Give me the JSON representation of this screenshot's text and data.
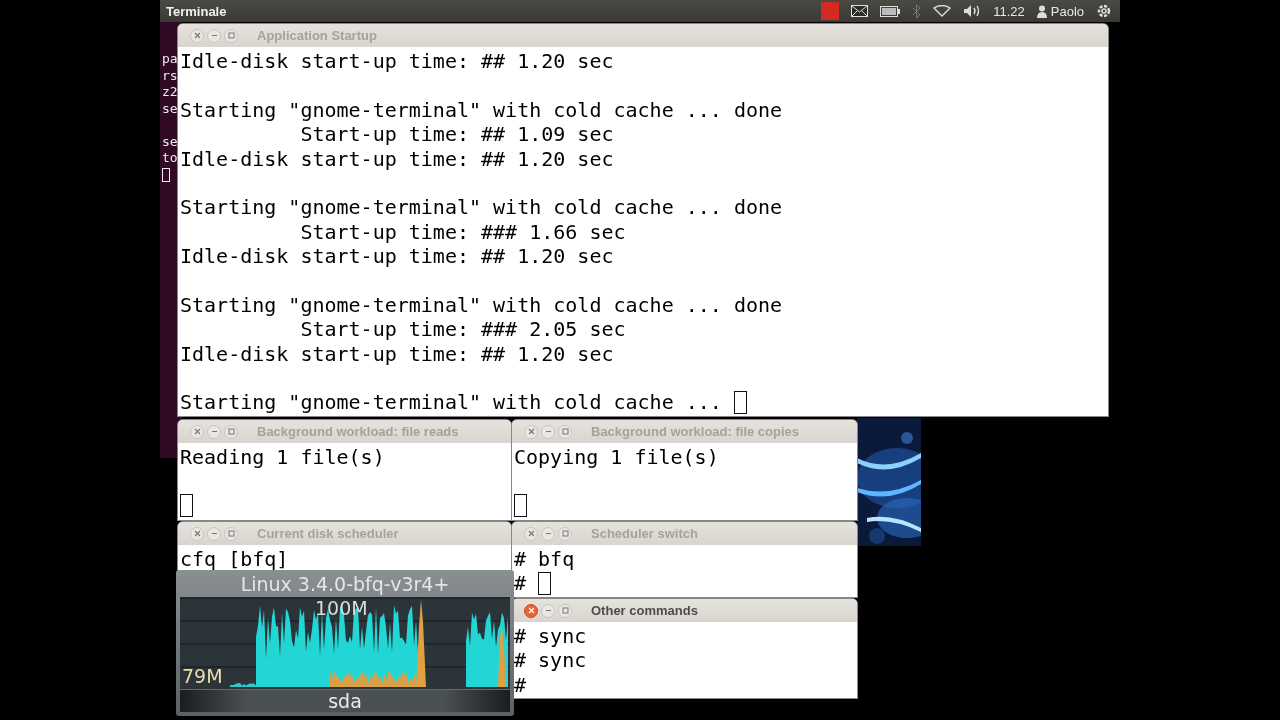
{
  "panel": {
    "app_title": "Terminale",
    "clock": "11.22",
    "user": "Paolo"
  },
  "background_terminal": {
    "lines": [
      {
        "kind": "text",
        "text": "pa"
      },
      {
        "kind": "text",
        "text": "rs"
      },
      {
        "kind": "text",
        "text": "z2"
      },
      {
        "kind": "text",
        "text": "se"
      },
      {
        "kind": "blank"
      },
      {
        "kind": "text",
        "text": "se"
      },
      {
        "kind": "text",
        "text": "to"
      },
      {
        "kind": "cursor"
      }
    ]
  },
  "windows": [
    {
      "title": "Application Startup",
      "active": false,
      "lines": [
        {
          "kind": "text",
          "text": "Idle-disk start-up time: ## 1.20 sec"
        },
        {
          "kind": "blank"
        },
        {
          "kind": "text",
          "text": "Starting \"gnome-terminal\" with cold cache ... done"
        },
        {
          "kind": "text",
          "text": "          Start-up time: ## 1.09 sec"
        },
        {
          "kind": "text",
          "text": "Idle-disk start-up time: ## 1.20 sec"
        },
        {
          "kind": "blank"
        },
        {
          "kind": "text",
          "text": "Starting \"gnome-terminal\" with cold cache ... done"
        },
        {
          "kind": "text",
          "text": "          Start-up time: ### 1.66 sec"
        },
        {
          "kind": "text",
          "text": "Idle-disk start-up time: ## 1.20 sec"
        },
        {
          "kind": "blank"
        },
        {
          "kind": "text",
          "text": "Starting \"gnome-terminal\" with cold cache ... done"
        },
        {
          "kind": "text",
          "text": "          Start-up time: ### 2.05 sec"
        },
        {
          "kind": "text",
          "text": "Idle-disk start-up time: ## 1.20 sec"
        },
        {
          "kind": "blank"
        },
        {
          "kind": "text",
          "text": "Starting \"gnome-terminal\" with cold cache ...",
          "cursor": true
        }
      ]
    },
    {
      "title": "Background workload: file reads",
      "active": false,
      "lines": [
        {
          "kind": "text",
          "text": "Reading 1 file(s)"
        },
        {
          "kind": "blank"
        },
        {
          "kind": "cursor"
        }
      ]
    },
    {
      "title": "Background workload: file copies",
      "active": false,
      "lines": [
        {
          "kind": "text",
          "text": "Copying 1 file(s)"
        },
        {
          "kind": "blank"
        },
        {
          "kind": "cursor"
        }
      ]
    },
    {
      "title": "Current disk scheduler",
      "active": false,
      "lines": [
        {
          "kind": "text",
          "text": "cfq [bfq]"
        }
      ]
    },
    {
      "title": "Scheduler switch",
      "active": false,
      "lines": [
        {
          "kind": "text",
          "text": "# bfq"
        },
        {
          "kind": "text",
          "text": "#",
          "cursor": true
        }
      ]
    },
    {
      "title": "Other commands",
      "active": true,
      "lines": [
        {
          "kind": "text",
          "text": "# sync"
        },
        {
          "kind": "text",
          "text": "# sync"
        },
        {
          "kind": "text",
          "text": "#"
        }
      ]
    }
  ],
  "disk_monitor": {
    "title": "Linux 3.4.0-bfq-v3r4+",
    "top_label": "100M",
    "current_label": "79M",
    "device": "sda"
  }
}
